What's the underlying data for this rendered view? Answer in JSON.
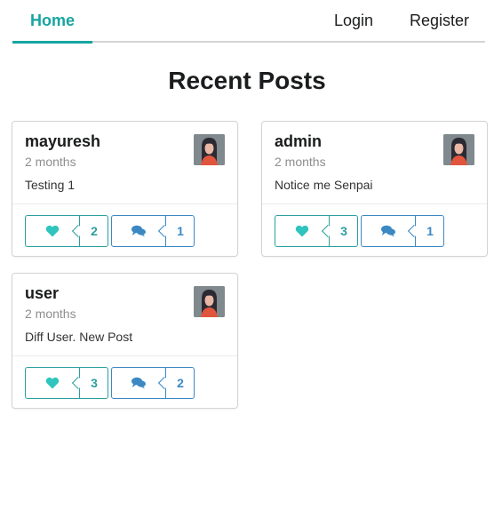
{
  "nav": {
    "home": "Home",
    "login": "Login",
    "register": "Register"
  },
  "page": {
    "title": "Recent Posts"
  },
  "colors": {
    "accent": "#17a5a0",
    "like": "#2a9fa0",
    "comment": "#3b88c3"
  },
  "posts": [
    {
      "username": "mayuresh",
      "time": "2 months",
      "body": "Testing 1",
      "likes": "2",
      "comments": "1"
    },
    {
      "username": "admin",
      "time": "2 months",
      "body": "Notice me Senpai",
      "likes": "3",
      "comments": "1"
    },
    {
      "username": "user",
      "time": "2 months",
      "body": "Diff User. New Post",
      "likes": "3",
      "comments": "2"
    }
  ]
}
